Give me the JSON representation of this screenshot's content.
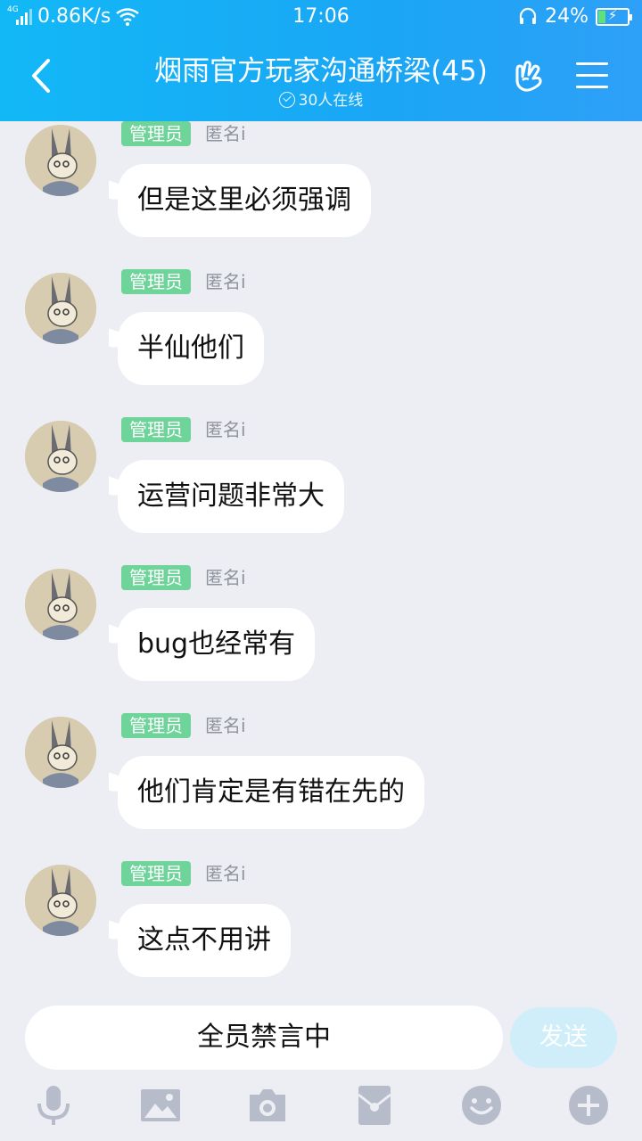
{
  "status_bar": {
    "network": "4G",
    "speed": "0.86K/s",
    "time": "17:06",
    "battery": "24%",
    "battery_level": 0.24
  },
  "header": {
    "title": "烟雨官方玩家沟通桥梁(45)",
    "online": "30人在线"
  },
  "messages": [
    {
      "badge": "管理员",
      "nick": "匿名i",
      "text": "但是这里必须强调"
    },
    {
      "badge": "管理员",
      "nick": "匿名i",
      "text": "半仙他们"
    },
    {
      "badge": "管理员",
      "nick": "匿名i",
      "text": "运营问题非常大"
    },
    {
      "badge": "管理员",
      "nick": "匿名i",
      "text": "bug也经常有"
    },
    {
      "badge": "管理员",
      "nick": "匿名i",
      "text": "他们肯定是有错在先的"
    },
    {
      "badge": "管理员",
      "nick": "匿名i",
      "text": "这点不用讲"
    }
  ],
  "input": {
    "muted_text": "全员禁言中",
    "send_label": "发送"
  },
  "toolbar": [
    "mic-icon",
    "image-icon",
    "camera-icon",
    "red-packet-icon",
    "emoji-icon",
    "plus-icon"
  ],
  "colors": {
    "header_start": "#12b8f6",
    "header_end": "#2ea0f7",
    "admin_badge": "#6ed49a",
    "background": "#eceef4",
    "send_disabled": "#cfeef9",
    "toolbar_icon": "#b6bcc9"
  }
}
